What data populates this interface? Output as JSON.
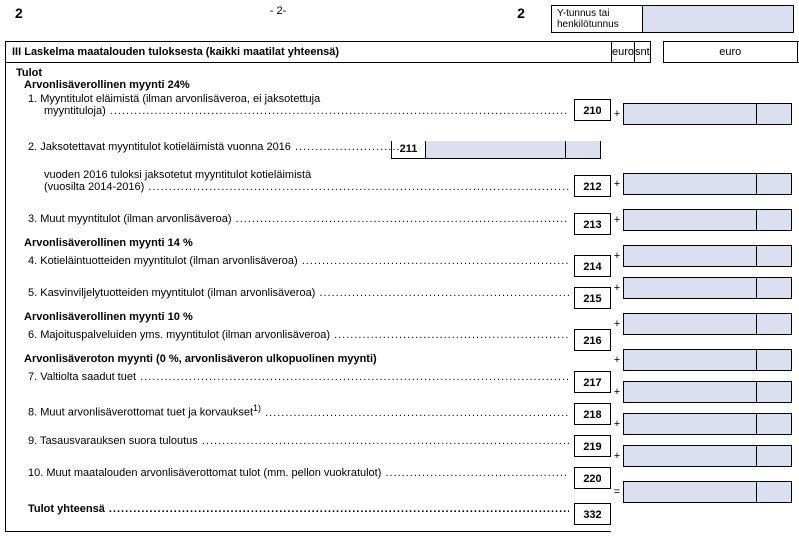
{
  "header": {
    "left_num": "2",
    "page": "- 2-",
    "right_num": "2",
    "ybox_label": "Y-tunnus tai henkilötunnus"
  },
  "section": {
    "title": "III Laskelma maatalouden tuloksesta (kaikki maatilat yhteensä)",
    "euro": "euro",
    "snt": "snt"
  },
  "labels": {
    "tulot": "Tulot",
    "alv24": "Arvonlisäverollinen myynti 24%",
    "r1": "1. Myyntitulot eläimistä (ilman arvonlisäveroa, ei jaksotettuja",
    "r1b": "myyntituloja)",
    "r2": "2. Jaksotettavat myyntitulot kotieläimistä vuonna 2016",
    "r2b": "vuoden 2016 tuloksi jaksotetut myyntitulot kotieläimistä",
    "r2c": "(vuosilta 2014-2016)",
    "r3": "3. Muut myyntitulot (ilman arvonlisäveroa)",
    "alv14": "Arvonlisäverollinen myynti 14 %",
    "r4": "4. Kotieläintuotteiden myyntitulot (ilman arvonlisäveroa)",
    "r5": "5. Kasvinviljelytuotteiden myyntitulot (ilman arvonlisäveroa)",
    "alv10": "Arvonlisäverollinen myynti 10 %",
    "r6": "6. Majoituspalveluiden yms. myyntitulot (ilman arvonlisäveroa)",
    "alv0": "Arvonlisäveroton myynti  (0 %, arvonlisäveron ulkopuolinen myynti)",
    "r7": "7. Valtiolta saadut tuet",
    "r8": "8. Muut arvonlisäverottomat tuet ja korvaukset",
    "r8sup": "1)",
    "r9": "9. Tasausvarauksen suora tuloutus",
    "r10": "10. Muut maatalouden arvonlisäverottomat tulot (mm. pellon vuokratulot)",
    "total": "Tulot yhteensä"
  },
  "codes": {
    "c211": "211",
    "c210": "210",
    "c212": "212",
    "c213": "213",
    "c214": "214",
    "c215": "215",
    "c216": "216",
    "c217": "217",
    "c218": "218",
    "c219": "219",
    "c220": "220",
    "c332": "332"
  },
  "ops": {
    "plus": "+",
    "eq": "="
  }
}
